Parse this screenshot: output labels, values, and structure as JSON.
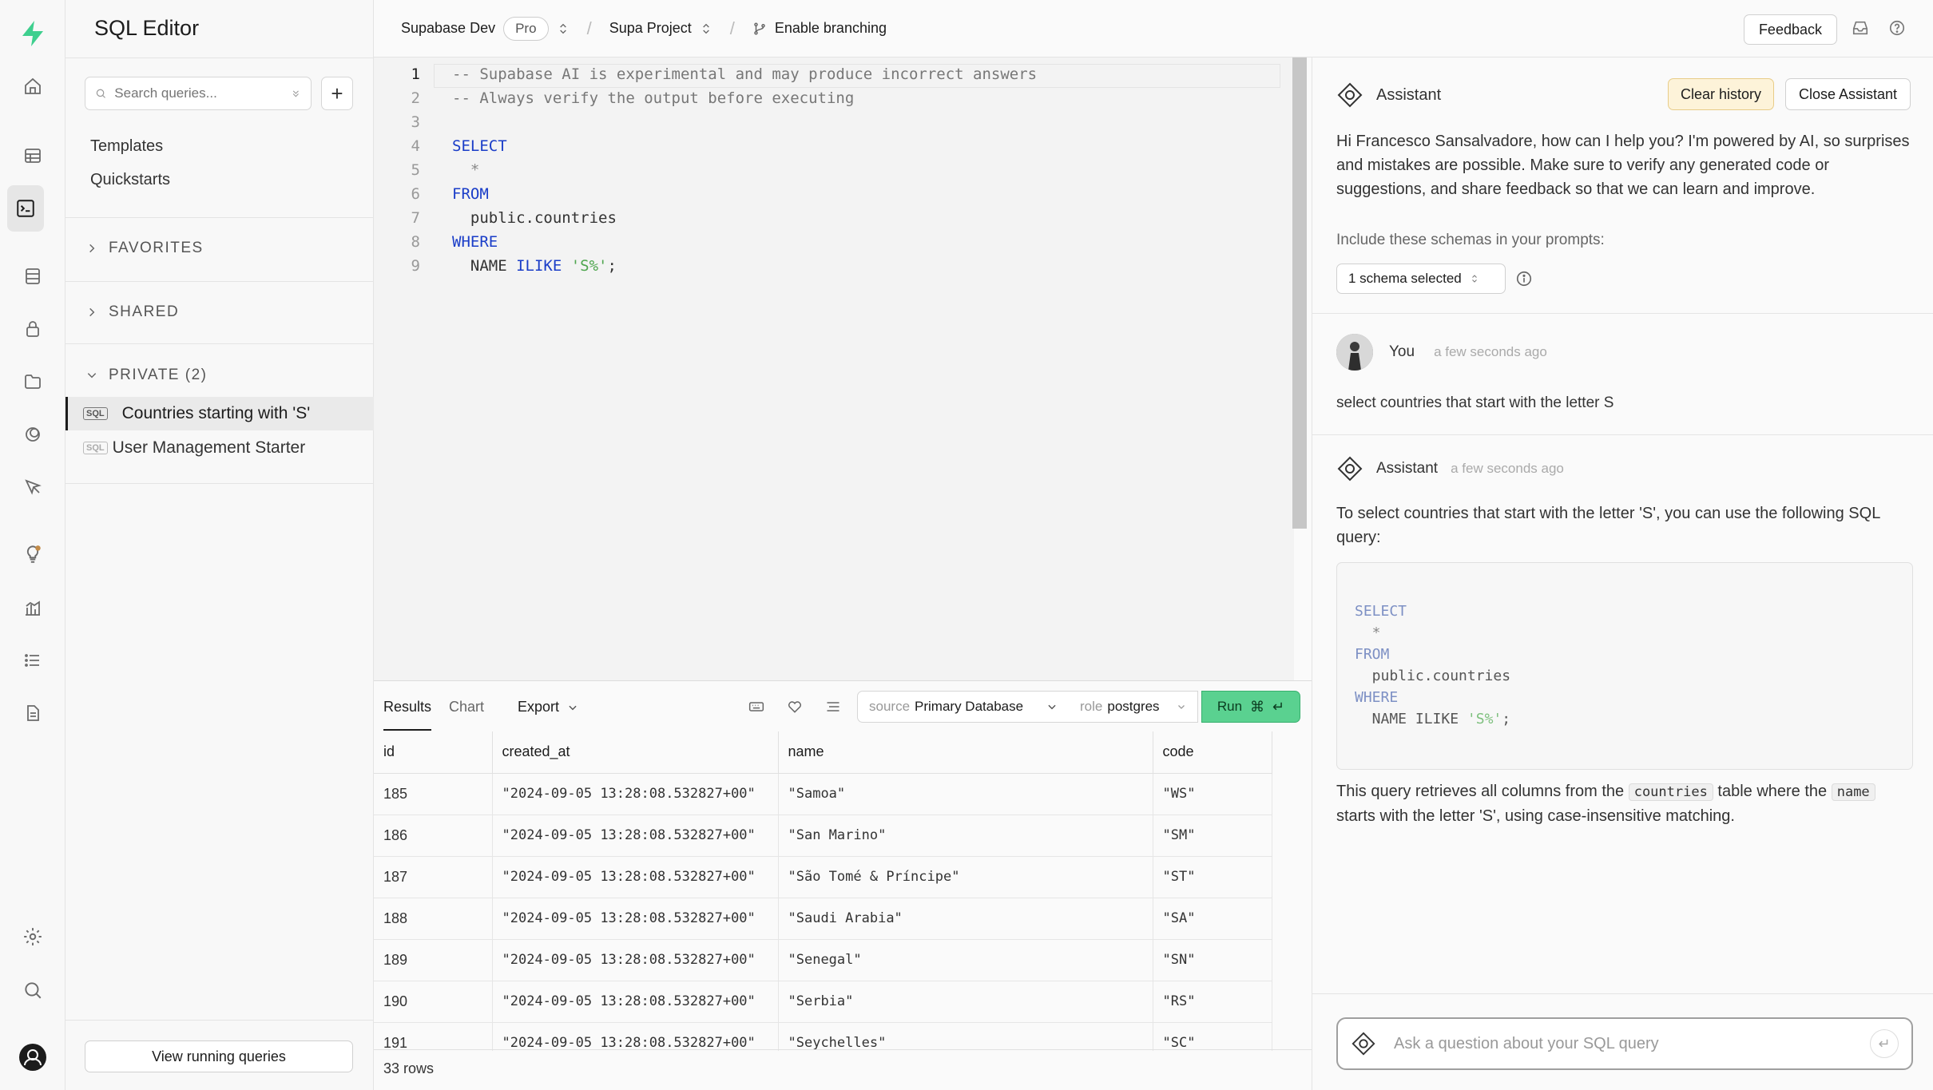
{
  "topbar": {
    "org": "Supabase Dev",
    "plan": "Pro",
    "project": "Supa Project",
    "branching": "Enable branching",
    "feedback": "Feedback"
  },
  "sidebar": {
    "title": "SQL Editor",
    "search_placeholder": "Search queries...",
    "links": [
      "Templates",
      "Quickstarts"
    ],
    "sections": [
      "FAVORITES",
      "SHARED",
      "PRIVATE (2)"
    ],
    "queries": [
      {
        "label": "Countries starting with 'S'",
        "badge": "SQL"
      },
      {
        "label": "User Management Starter",
        "badge": "SQL"
      }
    ],
    "view_running": "View running queries"
  },
  "editor": {
    "lines": [
      "-- Supabase AI is experimental and may produce incorrect answers",
      "-- Always verify the output before executing",
      "",
      "SELECT",
      "  *",
      "FROM",
      "  public.countries",
      "WHERE",
      "  NAME ILIKE 'S%';"
    ]
  },
  "results": {
    "tabs": [
      "Results",
      "Chart"
    ],
    "export": "Export",
    "source_label": "source",
    "source_value": "Primary Database",
    "role_label": "role",
    "role_value": "postgres",
    "run": "Run",
    "columns": [
      "id",
      "created_at",
      "name",
      "code"
    ],
    "rows": [
      [
        "185",
        "\"2024-09-05 13:28:08.532827+00\"",
        "\"Samoa\"",
        "\"WS\""
      ],
      [
        "186",
        "\"2024-09-05 13:28:08.532827+00\"",
        "\"San Marino\"",
        "\"SM\""
      ],
      [
        "187",
        "\"2024-09-05 13:28:08.532827+00\"",
        "\"São Tomé & Príncipe\"",
        "\"ST\""
      ],
      [
        "188",
        "\"2024-09-05 13:28:08.532827+00\"",
        "\"Saudi Arabia\"",
        "\"SA\""
      ],
      [
        "189",
        "\"2024-09-05 13:28:08.532827+00\"",
        "\"Senegal\"",
        "\"SN\""
      ],
      [
        "190",
        "\"2024-09-05 13:28:08.532827+00\"",
        "\"Serbia\"",
        "\"RS\""
      ],
      [
        "191",
        "\"2024-09-05 13:28:08.532827+00\"",
        "\"Seychelles\"",
        "\"SC\""
      ]
    ],
    "row_count": "33 rows"
  },
  "assistant": {
    "title": "Assistant",
    "clear_history": "Clear history",
    "close": "Close Assistant",
    "intro": "Hi Francesco Sansalvadore, how can I help you? I'm powered by AI, so surprises and mistakes are possible. Make sure to verify any generated code or suggestions, and share feedback so that we can learn and improve.",
    "schema_prompt": "Include these schemas in your prompts:",
    "schema_selected": "1 schema selected",
    "user_name": "You",
    "user_time": "a few seconds ago",
    "user_message": "select countries that start with the letter S",
    "reply_name": "Assistant",
    "reply_time": "a few seconds ago",
    "reply_text": "To select countries that start with the letter 'S', you can use the following SQL query:",
    "reply_code": [
      "SELECT",
      "  *",
      "FROM",
      "  public.countries",
      "WHERE",
      "  NAME ILIKE 'S%';"
    ],
    "reply_after_1": "This query retrieves all columns from the",
    "reply_code_table": "countries",
    "reply_after_2": "table where the",
    "reply_code_col": "name",
    "reply_after_3": "starts with the letter 'S', using case-insensitive matching.",
    "ask_placeholder": "Ask a question about your SQL query"
  },
  "colors": {
    "accent": "#3ecf8e",
    "run_button": "#5ad190",
    "clear_history_bg": "#fdf3d9"
  }
}
